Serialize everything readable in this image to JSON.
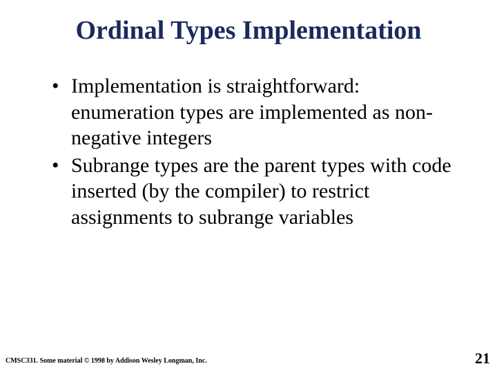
{
  "title": "Ordinal Types Implementation",
  "bullets": [
    "Implementation is straightforward: enumeration types are implemented as non-negative integers",
    "Subrange types are the parent types with code inserted (by the compiler) to restrict assignments to subrange variables"
  ],
  "footer_left": "CMSC331.  Some material © 1998 by Addison Wesley Longman, Inc.",
  "page_number": "21"
}
